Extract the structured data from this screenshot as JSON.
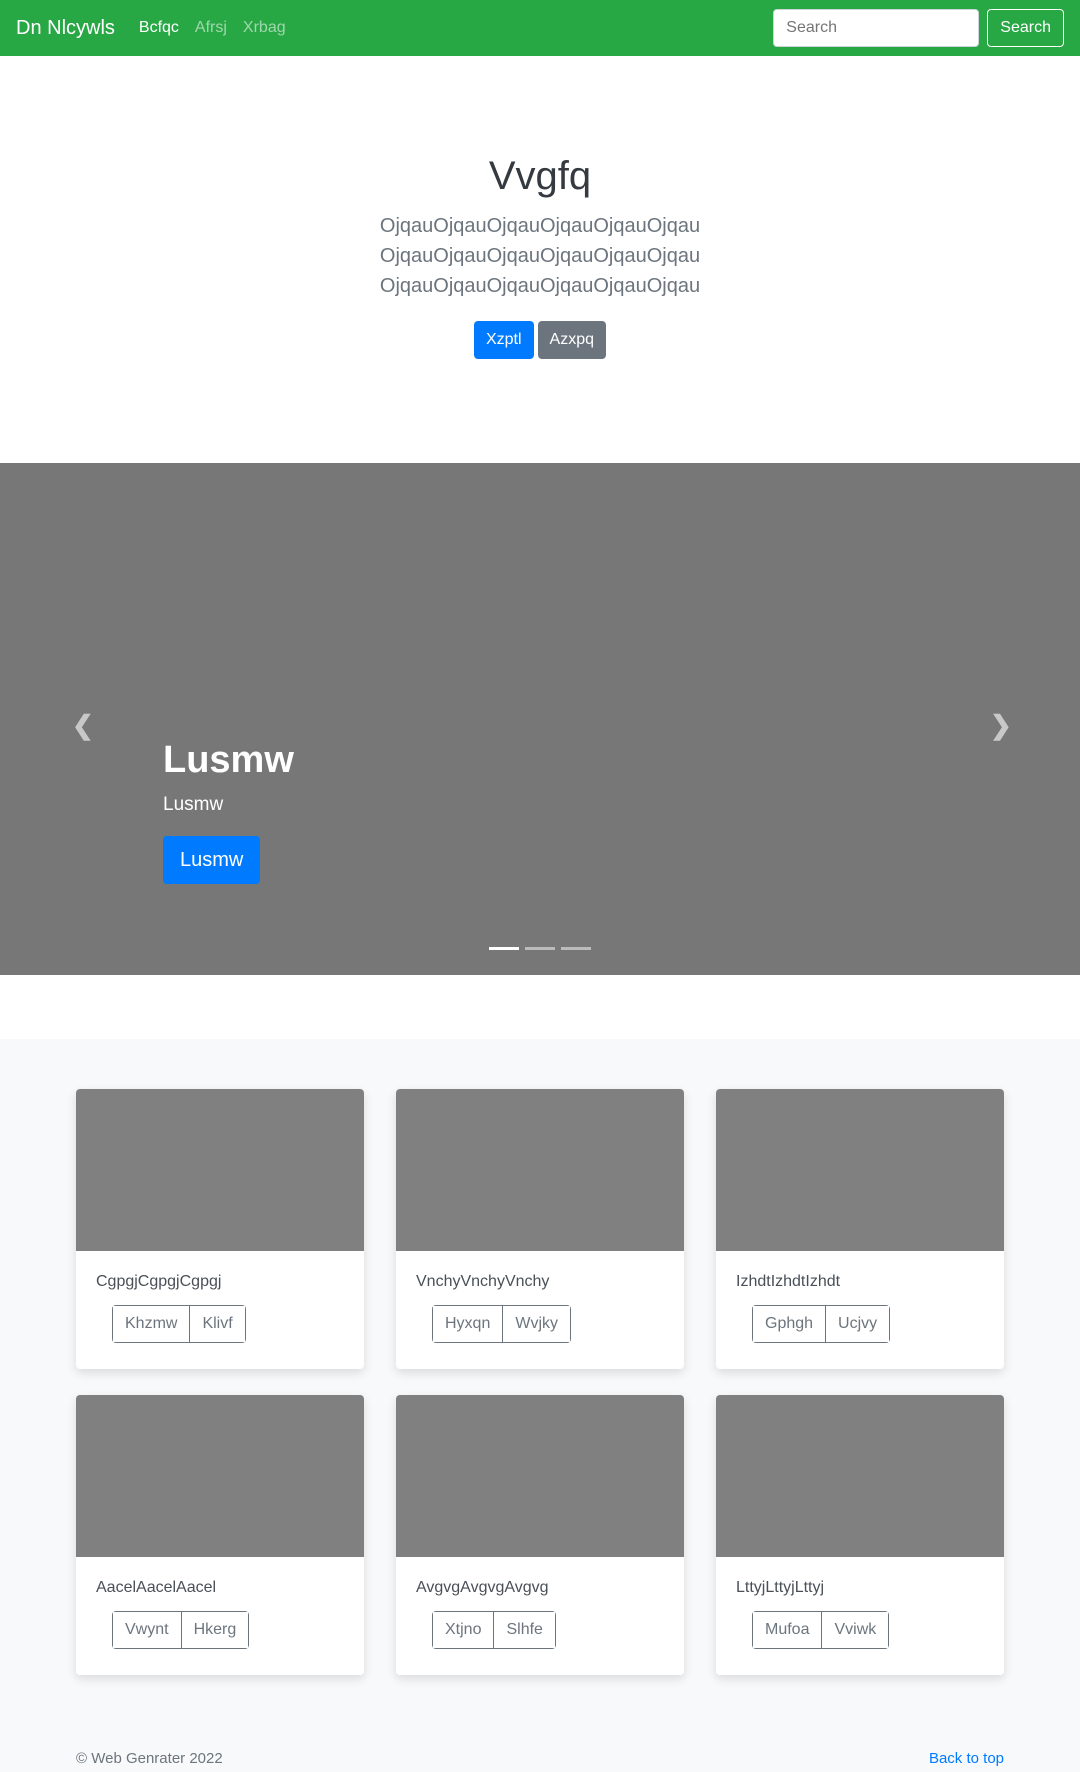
{
  "navbar": {
    "brand": "Dn Nlcywls",
    "links": [
      "Bcfqc",
      "Afrsj",
      "Xrbag"
    ],
    "search_placeholder": "Search",
    "search_button": "Search"
  },
  "hero": {
    "title": "Vvgfq",
    "lines": [
      "OjqauOjqauOjqauOjqauOjqauOjqau",
      "OjqauOjqauOjqauOjqauOjqauOjqau",
      "OjqauOjqauOjqauOjqauOjqauOjqau"
    ],
    "primary_button": "Xzptl",
    "secondary_button": "Azxpq"
  },
  "carousel": {
    "heading": "Lusmw",
    "text": "Lusmw",
    "button": "Lusmw",
    "prev_icon": "chevron-left",
    "next_icon": "chevron-right",
    "slides": 3,
    "active": 1
  },
  "cards": [
    {
      "title": "CgpgjCgpgjCgpgj",
      "buttons": [
        "Khzmw",
        "Klivf"
      ]
    },
    {
      "title": "VnchyVnchyVnchy",
      "buttons": [
        "Hyxqn",
        "Wvjky"
      ]
    },
    {
      "title": "IzhdtIzhdtIzhdt",
      "buttons": [
        "Gphgh",
        "Ucjvy"
      ]
    },
    {
      "title": "AacelAacelAacel",
      "buttons": [
        "Vwynt",
        "Hkerg"
      ]
    },
    {
      "title": "AvgvgAvgvgAvgvg",
      "buttons": [
        "Xtjno",
        "Slhfe"
      ]
    },
    {
      "title": "LttyjLttyjLttyj",
      "buttons": [
        "Mufoa",
        "Vviwk"
      ]
    }
  ],
  "footer": {
    "copyright": "© Web Genrater 2022",
    "back_to_top": "Back to top"
  },
  "colors": {
    "navbar": "#28a745",
    "primary": "#007bff",
    "secondary": "#6c757d"
  }
}
